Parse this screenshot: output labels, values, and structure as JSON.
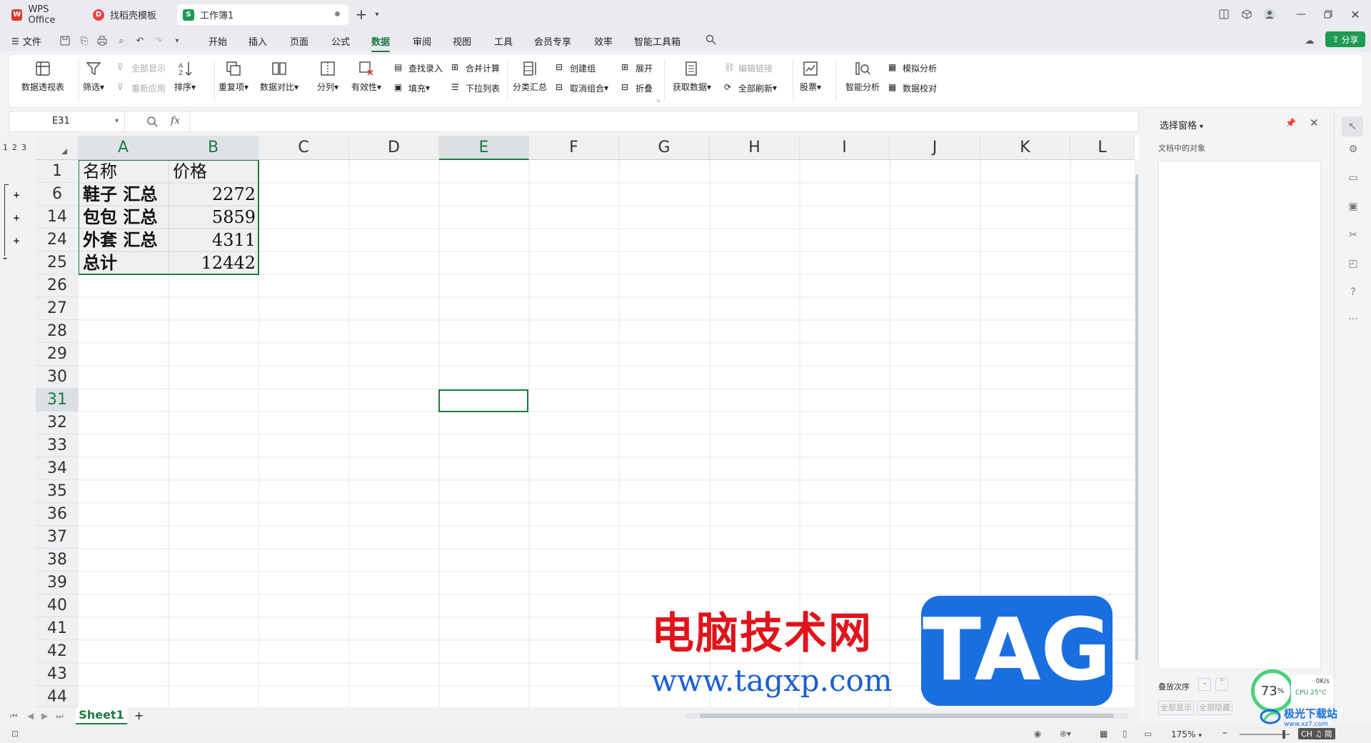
{
  "titlebar": {
    "tabs": [
      {
        "label": "WPS Office",
        "icon": "wps-logo-icon",
        "color": "#d93a2b"
      },
      {
        "label": "找稻壳模板",
        "icon": "docer-icon",
        "color": "#e64545"
      },
      {
        "label": "工作簿1",
        "icon": "spreadsheet-icon",
        "color": "#1e9a52",
        "badge": "S"
      }
    ],
    "new_tab": "+"
  },
  "menubar": {
    "file": "文件",
    "items": [
      "开始",
      "插入",
      "页面",
      "公式",
      "数据",
      "审阅",
      "视图",
      "工具",
      "会员专享",
      "效率",
      "智能工具箱"
    ],
    "active": "数据",
    "share": "分享"
  },
  "ribbon": {
    "pivot": "数据透视表",
    "filter": "筛选",
    "show_all": "全部显示",
    "reapply": "重新应用",
    "sort": "排序",
    "duplicates": "重复项",
    "compare": "数据对比",
    "split": "分列",
    "validity": "有效性",
    "lookup": "查找录入",
    "fill": "填充",
    "consolidate": "合并计算",
    "dropdown": "下拉列表",
    "subtotal": "分类汇总",
    "create_group": "创建组",
    "ungroup": "取消组合",
    "expand": "展开",
    "collapse": "折叠",
    "get_data": "获取数据",
    "edit_links": "编辑链接",
    "refresh_all": "全部刷新",
    "stocks": "股票",
    "smart_analysis": "智能分析",
    "simulation": "模拟分析",
    "data_check": "数据校对"
  },
  "formula": {
    "name_box": "E31",
    "fx": "fx",
    "value": ""
  },
  "grid": {
    "columns": [
      "A",
      "B",
      "C",
      "D",
      "E",
      "F",
      "G",
      "H",
      "I",
      "J",
      "K",
      "L"
    ],
    "selected_column": "E",
    "row_numbers": [
      "1",
      "6",
      "14",
      "24",
      "25",
      "26",
      "27",
      "28",
      "29",
      "30",
      "31",
      "32",
      "33",
      "34",
      "35",
      "36",
      "37",
      "38",
      "39",
      "40",
      "41",
      "42",
      "43",
      "44"
    ],
    "selected_row": "31",
    "outline_levels": [
      "1",
      "2",
      "3"
    ],
    "rows": [
      {
        "a": "名称",
        "b": "价格"
      },
      {
        "a": "鞋子 汇总",
        "b": "2272"
      },
      {
        "a": "包包 汇总",
        "b": "5859"
      },
      {
        "a": "外套 汇总",
        "b": "4311"
      },
      {
        "a": "总计",
        "b": "12442"
      }
    ]
  },
  "sheets": {
    "active": "Sheet1",
    "add": "+"
  },
  "selection_pane": {
    "title": "选择窗格",
    "subtitle": "文档中的对象",
    "order_label": "叠放次序",
    "show_all": "全部显示",
    "hide_all": "全部隐藏"
  },
  "status": {
    "zoom": "175%",
    "ime": "CH ♫ 简"
  },
  "widget": {
    "percent": "73",
    "percent_unit": "%",
    "net": "0K/s",
    "cpu": "CPU 25°C"
  },
  "watermark": {
    "site_cn": "电脑技术网",
    "url": "www.tagxp.com",
    "tag": "TAG",
    "brand": "极光下载站",
    "brand_url": "www.xz7.com"
  },
  "colors": {
    "accent": "#1e7a45",
    "share_btn": "#1e9a52",
    "watermark_red": "#e0141c",
    "watermark_blue": "#1a5fd0",
    "tag_bg": "#1a6fe0"
  }
}
